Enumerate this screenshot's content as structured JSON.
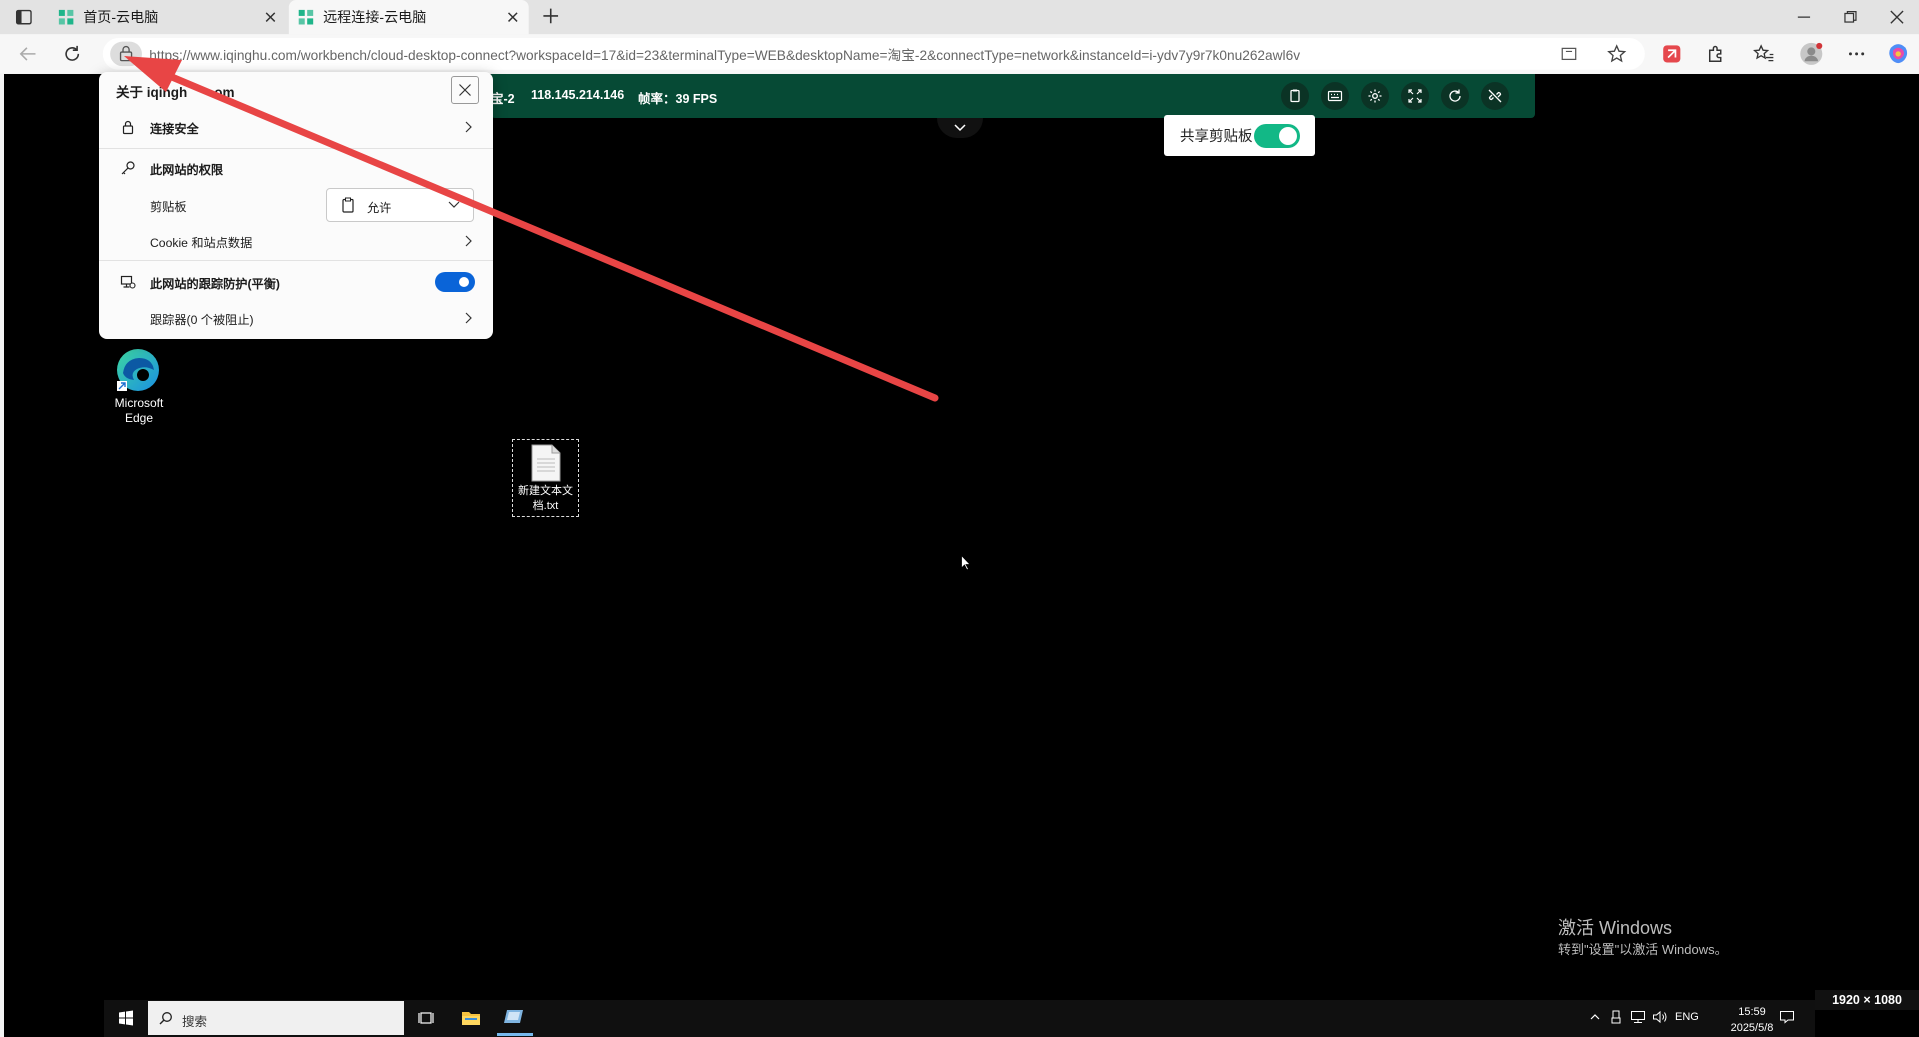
{
  "browser": {
    "tabs": [
      {
        "title": "首页-云电脑",
        "active": false
      },
      {
        "title": "远程连接-云电脑",
        "active": true
      }
    ],
    "url": "https://www.iqinghu.com/workbench/cloud-desktop-connect?workspaceId=17&id=23&terminalType=WEB&desktopName=淘宝-2&connectType=network&instanceId=i-ydv7y9r7k0nu262awl6v"
  },
  "site_popup": {
    "title_prefix": "关于 iqingh",
    "title_suffix": "om",
    "connection_security": "连接安全",
    "permissions_heading": "此网站的权限",
    "clipboard_label": "剪贴板",
    "clipboard_value": "允许",
    "cookie_label": "Cookie 和站点数据",
    "tracking_label": "此网站的跟踪防护(平衡)",
    "tracking_enabled": true,
    "trackers_label": "跟踪器(0 个被阻止)"
  },
  "remote_toolbar": {
    "desktop_name_partial": "宝-2",
    "ip": "118.145.214.146",
    "fps_label": "帧率：39 FPS"
  },
  "share_clipboard": {
    "label": "共享剪贴板",
    "enabled": true
  },
  "remote_desktop": {
    "icons": [
      {
        "label_line1": "Microsoft",
        "label_line2": "Edge",
        "icon": "edge-icon"
      },
      {
        "label_line1": "新建文本文",
        "label_line2": "档.txt",
        "icon": "text-file-icon"
      }
    ],
    "taskbar": {
      "search_placeholder": "搜索",
      "language": "ENG",
      "time": "15:59",
      "date": "2025/5/8"
    },
    "activation": {
      "title": "激活 Windows",
      "subtitle": "转到\"设置\"以激活 Windows。"
    },
    "resolution": "1920 × 1080"
  },
  "colors": {
    "toolbar_green": "#064a35",
    "switch_green": "#12b886",
    "toggle_blue": "#0a64d8",
    "arrow_red": "#e84545"
  }
}
